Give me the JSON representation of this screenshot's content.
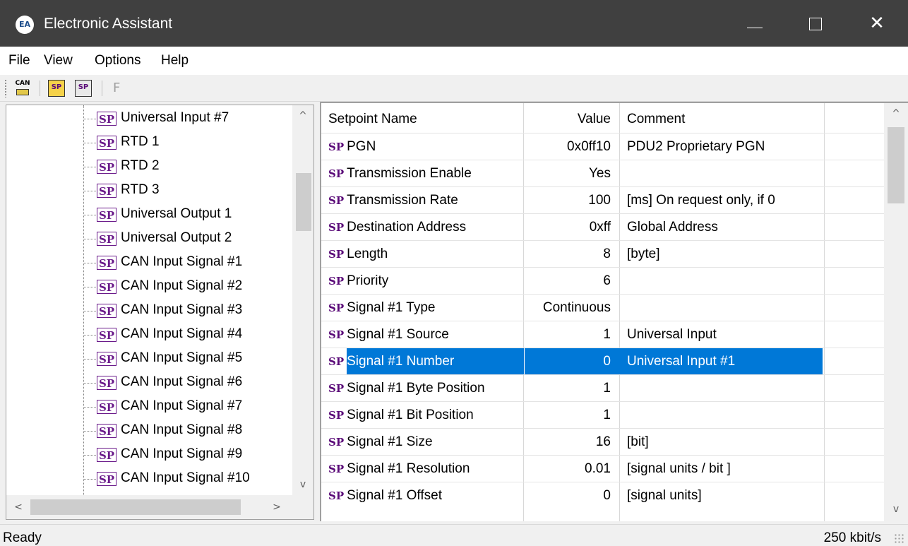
{
  "window": {
    "title": "Electronic Assistant",
    "app_icon": "EA",
    "min_icon": "minimize-icon",
    "max_icon": "maximize-icon",
    "close_glyph": "✕"
  },
  "menu": {
    "file": "File",
    "view": "View",
    "options": "Options",
    "help": "Help"
  },
  "toolbar": {
    "can_label": "CAN",
    "sp_label": "SP",
    "f_label": "F"
  },
  "tree": {
    "items": [
      {
        "icon": "SP",
        "label": "Universal Input #7"
      },
      {
        "icon": "SP",
        "label": "RTD 1"
      },
      {
        "icon": "SP",
        "label": "RTD 2"
      },
      {
        "icon": "SP",
        "label": "RTD 3"
      },
      {
        "icon": "SP",
        "label": "Universal Output 1"
      },
      {
        "icon": "SP",
        "label": "Universal Output 2"
      },
      {
        "icon": "SP",
        "label": "CAN Input Signal #1"
      },
      {
        "icon": "SP",
        "label": "CAN Input Signal #2"
      },
      {
        "icon": "SP",
        "label": "CAN Input Signal #3"
      },
      {
        "icon": "SP",
        "label": "CAN Input Signal #4"
      },
      {
        "icon": "SP",
        "label": "CAN Input Signal #5"
      },
      {
        "icon": "SP",
        "label": "CAN Input Signal #6"
      },
      {
        "icon": "SP",
        "label": "CAN Input Signal #7"
      },
      {
        "icon": "SP",
        "label": "CAN Input Signal #8"
      },
      {
        "icon": "SP",
        "label": "CAN Input Signal #9"
      },
      {
        "icon": "SP",
        "label": "CAN Input Signal #10"
      }
    ],
    "scroll_up": "^",
    "scroll_down": "v",
    "scroll_left": "<",
    "scroll_right": ">"
  },
  "grid": {
    "headers": {
      "name": "Setpoint Name",
      "value": "Value",
      "comment": "Comment"
    },
    "rows": [
      {
        "sp": "SP",
        "name": "PGN",
        "value": "0x0ff10",
        "comment": "PDU2 Proprietary PGN"
      },
      {
        "sp": "SP",
        "name": "Transmission Enable",
        "value": "Yes",
        "comment": ""
      },
      {
        "sp": "SP",
        "name": "Transmission Rate",
        "value": "100",
        "comment": "[ms]  On request only, if 0"
      },
      {
        "sp": "SP",
        "name": "Destination Address",
        "value": "0xff",
        "comment": "Global Address"
      },
      {
        "sp": "SP",
        "name": "Length",
        "value": "8",
        "comment": "[byte]"
      },
      {
        "sp": "SP",
        "name": "Priority",
        "value": "6",
        "comment": ""
      },
      {
        "sp": "SP",
        "name": "Signal #1 Type",
        "value": "Continuous",
        "comment": ""
      },
      {
        "sp": "SP",
        "name": "Signal #1 Source",
        "value": "1",
        "comment": "Universal Input"
      },
      {
        "sp": "SP",
        "name": "Signal #1 Number",
        "value": "0",
        "comment": "Universal Input #1",
        "selected": true
      },
      {
        "sp": "SP",
        "name": "Signal #1 Byte Position",
        "value": "1",
        "comment": ""
      },
      {
        "sp": "SP",
        "name": "Signal #1 Bit Position",
        "value": "1",
        "comment": ""
      },
      {
        "sp": "SP",
        "name": "Signal #1 Size",
        "value": "16",
        "comment": "[bit]"
      },
      {
        "sp": "SP",
        "name": "Signal #1 Resolution",
        "value": "0.01",
        "comment": "[signal units / bit ]"
      },
      {
        "sp": "SP",
        "name": "Signal #1 Offset",
        "value": "0",
        "comment": "[signal units]"
      }
    ],
    "scroll_up": "^",
    "scroll_down": "v"
  },
  "status": {
    "left": "Ready",
    "right": "250 kbit/s"
  },
  "colors": {
    "titlebar": "#404040",
    "selection": "#0078d7",
    "sp_purple": "#5a0a78"
  }
}
